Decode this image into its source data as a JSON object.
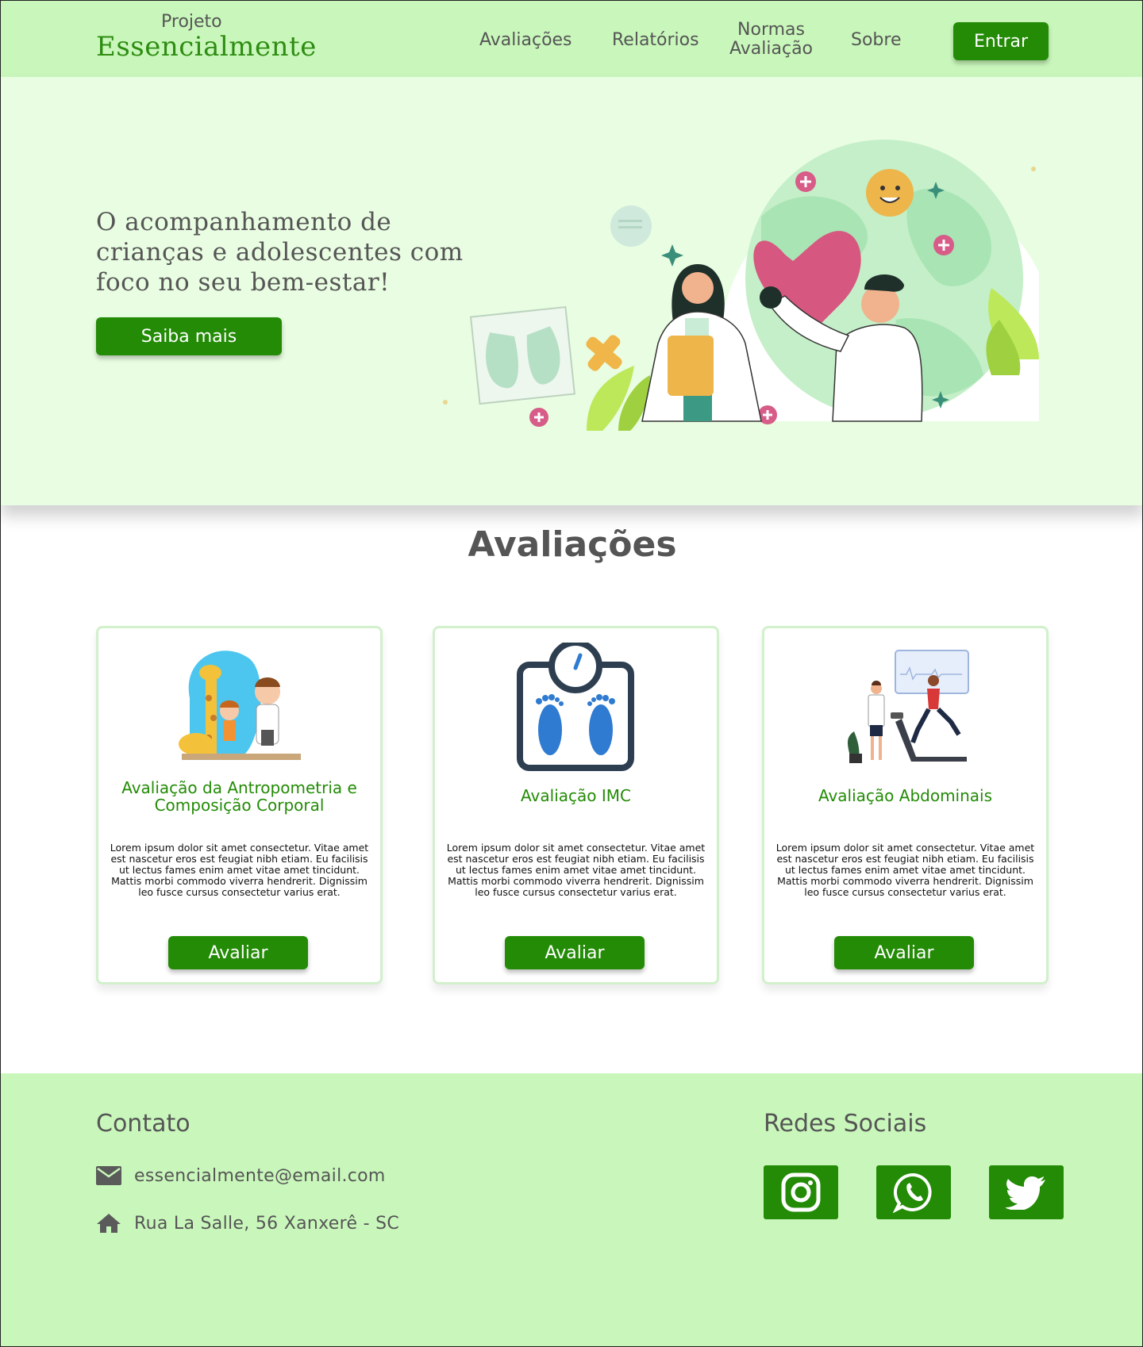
{
  "header": {
    "brand_small": "Projeto",
    "brand_big": "Essencialmente",
    "nav": [
      {
        "label": "Avaliações"
      },
      {
        "label": "Relatórios"
      },
      {
        "label_line1": "Normas",
        "label_line2": "Avaliação"
      },
      {
        "label": "Sobre"
      }
    ],
    "login_label": "Entrar"
  },
  "hero": {
    "title": "O acompanhamento de crianças e adolescentes com foco no seu bem-estar!",
    "cta_label": "Saiba mais"
  },
  "avaliacoes": {
    "title": "Avaliações",
    "cards": [
      {
        "title": "Avaliação da Antropometria e Composição Corporal",
        "text": "Lorem ipsum dolor sit amet consectetur. Vitae amet est nascetur eros est feugiat nibh etiam. Eu facilisis ut lectus fames enim amet vitae amet tincidunt. Mattis morbi commodo viverra hendrerit. Dignissim leo fusce cursus consectetur varius erat.",
        "button": "Avaliar",
        "icon": "growth-measurement-illustration"
      },
      {
        "title": "Avaliação IMC",
        "text": "Lorem ipsum dolor sit amet consectetur. Vitae amet est nascetur eros est feugiat nibh etiam. Eu facilisis ut lectus fames enim amet vitae amet tincidunt. Mattis morbi commodo viverra hendrerit. Dignissim leo fusce cursus consectetur varius erat.",
        "button": "Avaliar",
        "icon": "scale-icon"
      },
      {
        "title": "Avaliação Abdominais",
        "text": "Lorem ipsum dolor sit amet consectetur. Vitae amet est nascetur eros est feugiat nibh etiam. Eu facilisis ut lectus fames enim amet vitae amet tincidunt. Mattis morbi commodo viverra hendrerit. Dignissim leo fusce cursus consectetur varius erat.",
        "button": "Avaliar",
        "icon": "treadmill-illustration"
      }
    ]
  },
  "footer": {
    "contact_title": "Contato",
    "email": "essencialmente@email.com",
    "address": "Rua La Salle, 56 Xanxerê - SC",
    "social_title": "Redes Sociais",
    "social": [
      "instagram-icon",
      "whatsapp-icon",
      "twitter-icon"
    ]
  },
  "colors": {
    "header_bg": "#c9f7bb",
    "hero_bg": "#e8fde1",
    "primary_green": "#238b06",
    "text_gray": "#555555"
  }
}
